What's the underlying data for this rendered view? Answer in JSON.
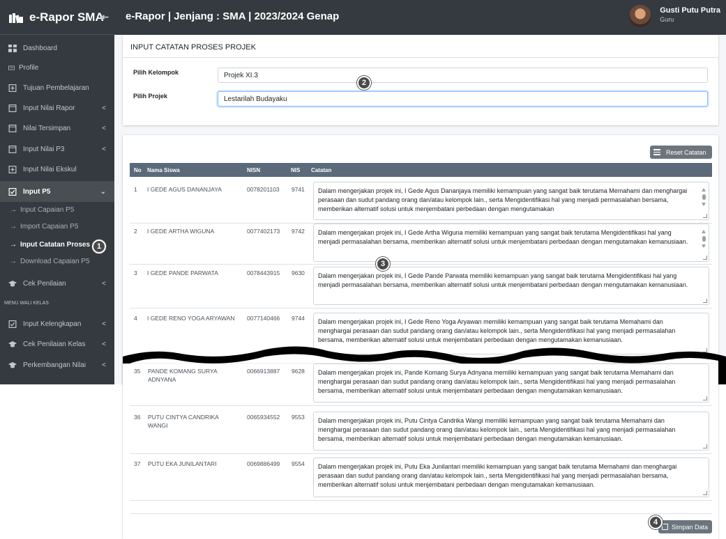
{
  "app": {
    "brand": "e-Rapor SMA",
    "collapse_icon": "⇤",
    "title": "e-Rapor | Jenjang : SMA | 2023/2024 Genap"
  },
  "user": {
    "name": "Gusti Putu Putra",
    "role": "Guru"
  },
  "sidebar": {
    "items": [
      {
        "label": "Dashboard",
        "icon": "grid-icon"
      },
      {
        "label": "Profile",
        "icon": "id-card-icon"
      },
      {
        "label": "Tujuan Pembelajaran",
        "icon": "plus-square-icon"
      },
      {
        "label": "Input Nilai Rapor",
        "icon": "square-icon",
        "chevron": "<"
      },
      {
        "label": "Nilai Tersimpan",
        "icon": "square-icon",
        "chevron": "<"
      },
      {
        "label": "Input Nilai P3",
        "icon": "square-icon",
        "chevron": "<"
      },
      {
        "label": "Input Nilai Ekskul",
        "icon": "plus-square-icon"
      },
      {
        "label": "Input P5",
        "icon": "check-square-icon",
        "chevron": "⌄"
      }
    ],
    "sub_items": [
      {
        "label": "Input Capaian P5"
      },
      {
        "label": "Import Capaian P5"
      },
      {
        "label": "Input Catatan Proses"
      },
      {
        "label": "Download Capaian P5"
      }
    ],
    "more_items": [
      {
        "label": "Cek Penilaian",
        "icon": "graduation-cap-icon",
        "chevron": "<"
      }
    ],
    "section_header": "MENU WALI KELAS",
    "wali_items": [
      {
        "label": "Input Kelengkapan",
        "icon": "check-square-icon",
        "chevron": "<"
      },
      {
        "label": "Cek Penilaian Kelas",
        "icon": "graduation-cap-icon",
        "chevron": "<"
      },
      {
        "label": "Perkembangan Nilai",
        "icon": "graduation-cap-icon",
        "chevron": "<"
      }
    ]
  },
  "form": {
    "title": "INPUT CATATAN PROSES PROJEK",
    "kelompok_label": "Pilih Kelompok",
    "kelompok_value": "Projek XI.3",
    "projek_label": "Pilih Projek",
    "projek_value": "Lestarilah Budayaku"
  },
  "table": {
    "reset_label": "Reset Catatan",
    "headers": {
      "no": "No",
      "nama": "Nama Siswa",
      "nisn": "NISN",
      "nis": "NIS",
      "catatan": "Catatan"
    },
    "rows": [
      {
        "no": "1",
        "nama": "I GEDE AGUS DANANJAYA",
        "nisn": "0078201103",
        "nis": "9741",
        "catatan": "Dalam mengerjakan projek ini, I Gede Agus Dananjaya memiliki kemampuan yang sangat baik terutama Memahami dan menghargai perasaan dan sudut pandang orang dan/atau kelompok lain., serta Mengidentifikasi hal yang menjadi permasalahan bersama, memberikan alternatif solusi untuk menjembatani perbedaan dengan mengutamakan"
      },
      {
        "no": "2",
        "nama": "I GEDE ARTHA WIGUNA",
        "nisn": "0077402173",
        "nis": "9742",
        "catatan": "Dalam mengerjakan projek ini, I Gede Artha Wiguna memiliki kemampuan yang sangat baik terutama Mengidentifikasi hal yang menjadi permasalahan bersama, memberikan alternatif solusi untuk menjembatani perbedaan dengan mengutamakan kemanusiaan."
      },
      {
        "no": "3",
        "nama": "I GEDE PANDE PARWATA",
        "nisn": "0078443915",
        "nis": "9630",
        "catatan": "Dalam mengerjakan projek ini, I Gede Pande Parwata memiliki kemampuan yang sangat baik terutama Mengidentifikasi hal yang menjadi permasalahan bersama, memberikan alternatif solusi untuk menjembatani perbedaan dengan mengutamakan kemanusiaan."
      },
      {
        "no": "4",
        "nama": "I GEDE RENO YOGA ARYAWAN",
        "nisn": "0077140466",
        "nis": "9744",
        "catatan": "Dalam mengerjakan projek ini, I Gede Reno Yoga Aryawan memiliki kemampuan yang sangat baik terutama Memahami dan menghargai perasaan dan sudut pandang orang dan/atau kelompok lain., serta Mengidentifikasi hal yang menjadi permasalahan bersama, memberikan alternatif solusi untuk menjembatani perbedaan dengan mengutamakan kemanusiaan."
      },
      {
        "no": "35",
        "nama": "PANDE KOMANG SURYA ADNYANA",
        "nisn": "0066913887",
        "nis": "9628",
        "catatan": "Dalam mengerjakan projek ini, Pande Komang Surya Adnyana memiliki kemampuan yang sangat baik terutama Memahami dan menghargai perasaan dan sudut pandang orang dan/atau kelompok lain., serta Mengidentifikasi hal yang menjadi permasalahan bersama, memberikan alternatif solusi untuk menjembatani perbedaan dengan mengutamakan kemanusiaan."
      },
      {
        "no": "36",
        "nama": "PUTU CINTYA CANDRIKA WANGI",
        "nisn": "0065934552",
        "nis": "9553",
        "catatan": "Dalam mengerjakan projek ini, Putu Cintya Candrika Wangi memiliki kemampuan yang sangat baik terutama Memahami dan menghargai perasaan dan sudut pandang orang dan/atau kelompok lain., serta Mengidentifikasi hal yang menjadi permasalahan bersama, memberikan alternatif solusi untuk menjembatani perbedaan dengan mengutamakan kemanusiaan."
      },
      {
        "no": "37",
        "nama": "PUTU EKA JUNILANTARI",
        "nisn": "0069886499",
        "nis": "9554",
        "catatan": "Dalam mengerjakan projek ini, Putu Eka Junilantari memiliki kemampuan yang sangat baik terutama Memahami dan menghargai perasaan dan sudut pandang orang dan/atau kelompok lain., serta Mengidentifikasi hal yang menjadi permasalahan bersama, memberikan alternatif solusi untuk menjembatani perbedaan dengan mengutamakan kemanusiaan."
      }
    ],
    "save_label": "Simpan Data"
  },
  "callouts": [
    "1",
    "2",
    "3",
    "4"
  ],
  "colors": {
    "sidebar": "#343a40",
    "table_header": "#5a6a7a",
    "button": "#6c757d",
    "focus": "#80bdff"
  }
}
